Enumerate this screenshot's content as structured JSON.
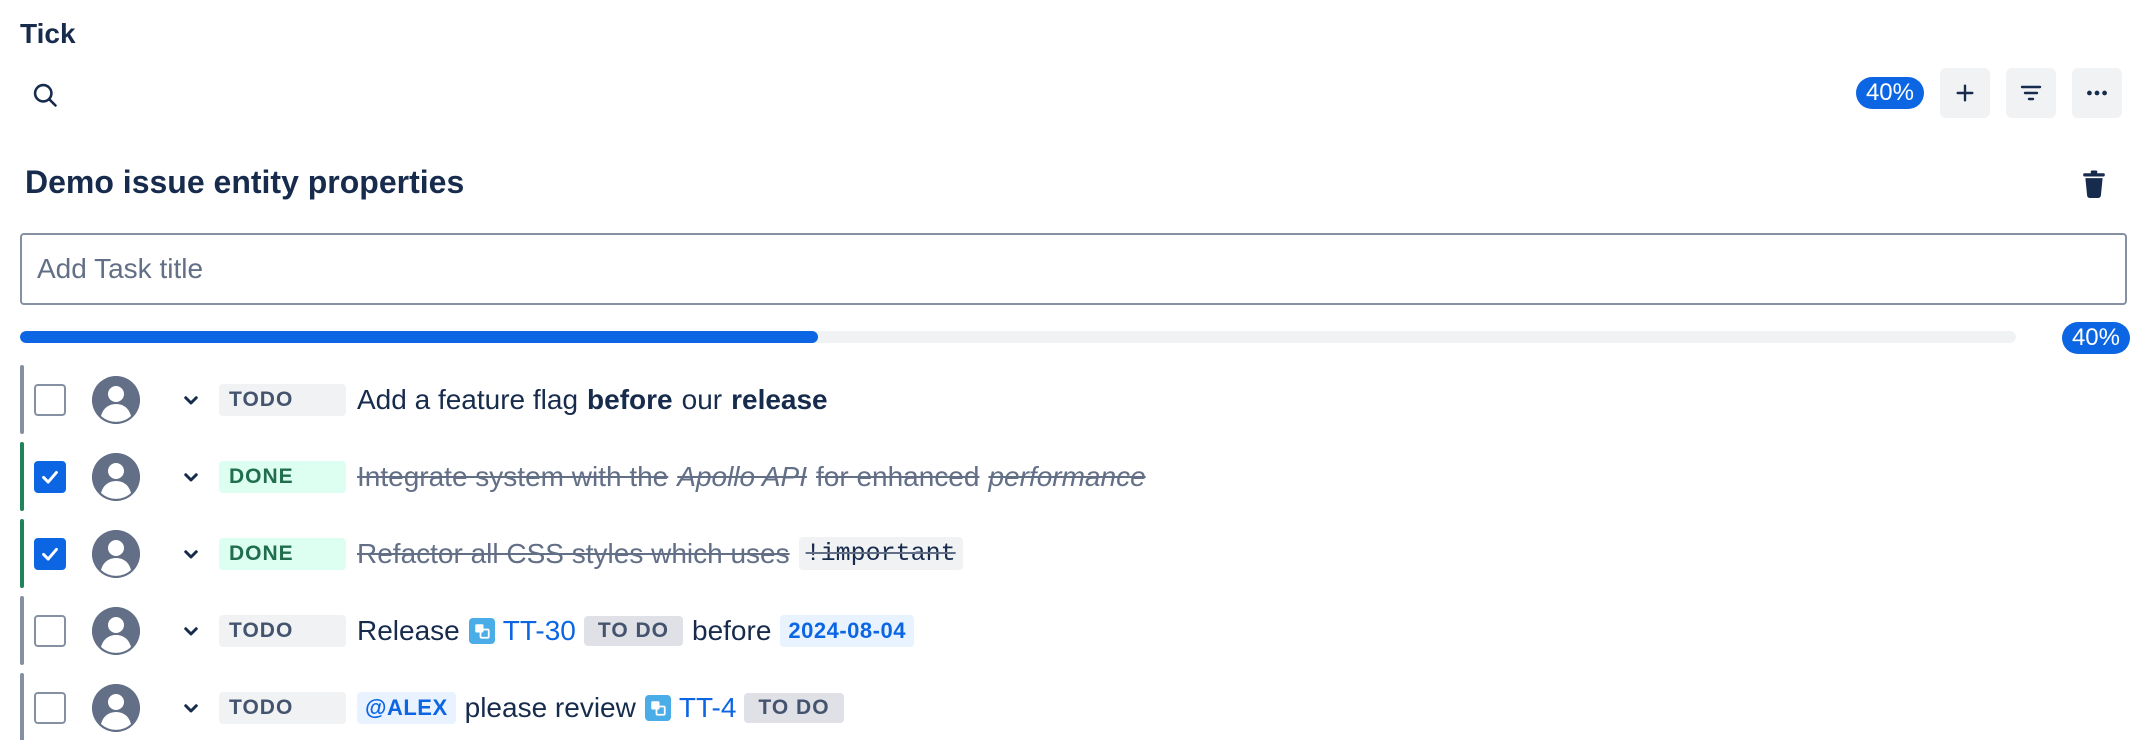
{
  "app": {
    "title": "Tick"
  },
  "toolbar": {
    "progress_badge": "40%",
    "icons": {
      "search": "search-icon",
      "add": "plus-icon",
      "filter": "filter-icon",
      "more": "more-icon"
    }
  },
  "page": {
    "title": "Demo issue entity properties",
    "delete_icon": "trash-icon"
  },
  "task_input": {
    "placeholder": "Add Task title",
    "value": ""
  },
  "progress": {
    "value": 0.4,
    "label": "40%"
  },
  "colors": {
    "accent": "#0c66e4",
    "done": "#1f845a",
    "todo": "#8590a2"
  },
  "tasks": [
    {
      "status": "TODO",
      "checked": false,
      "segments": [
        {
          "text": "Add a feature flag"
        },
        {
          "text": "before",
          "bold": true
        },
        {
          "text": "our"
        },
        {
          "text": "release",
          "bold": true
        }
      ]
    },
    {
      "status": "DONE",
      "checked": true,
      "segments": [
        {
          "text": "Integrate system with the"
        },
        {
          "text": "Apollo API",
          "italic": true
        },
        {
          "text": "for enhanced"
        },
        {
          "text": "performance",
          "italic": true
        }
      ]
    },
    {
      "status": "DONE",
      "checked": true,
      "segments": [
        {
          "text": "Refactor all CSS styles which uses"
        },
        {
          "text": "!important",
          "code": true
        }
      ]
    },
    {
      "status": "TODO",
      "checked": false,
      "segments": [
        {
          "text": "Release"
        },
        {
          "issue_key": "TT-30",
          "issue_status": "TO DO"
        },
        {
          "text": "before"
        },
        {
          "date": "2024-08-04"
        }
      ]
    },
    {
      "status": "TODO",
      "checked": false,
      "segments": [
        {
          "mention": "@ALEX"
        },
        {
          "text": "please review"
        },
        {
          "issue_key": "TT-4",
          "issue_status": "TO DO"
        }
      ]
    }
  ]
}
